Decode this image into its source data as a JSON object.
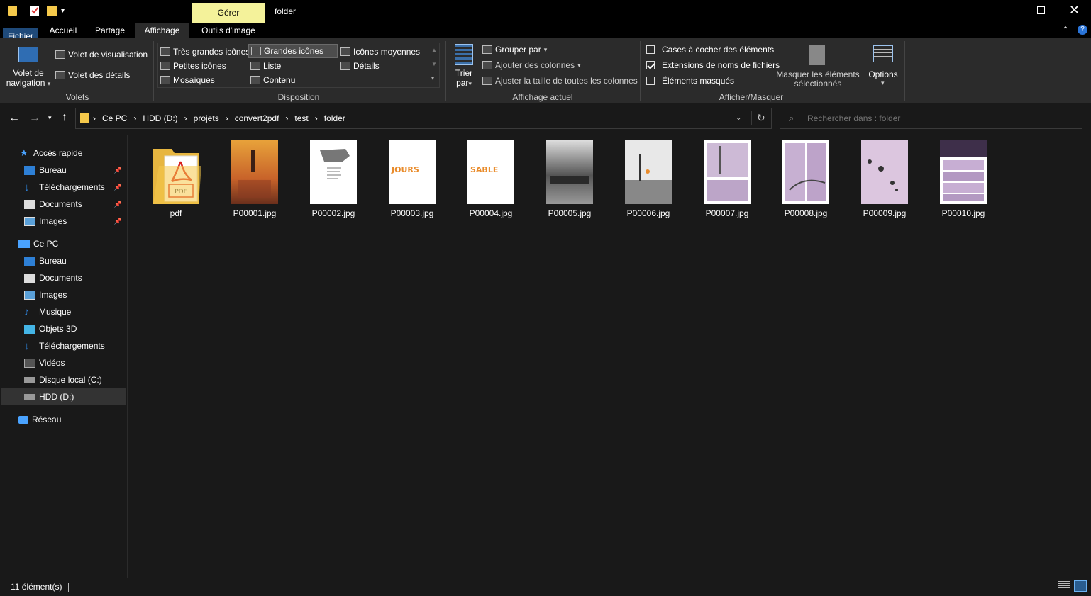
{
  "window": {
    "title": "folder"
  },
  "tabs": {
    "contextual": "Gérer",
    "fichier": "Fichier",
    "accueil": "Accueil",
    "partage": "Partage",
    "affichage": "Affichage",
    "outils": "Outils d'image"
  },
  "ribbon": {
    "volets": {
      "label": "Volets",
      "nav_pane_1": "Volet de",
      "nav_pane_2": "navigation",
      "preview": "Volet de visualisation",
      "details": "Volet des détails"
    },
    "disposition": {
      "label": "Disposition",
      "tres_grandes": "Très grandes icônes",
      "grandes": "Grandes icônes",
      "moyennes": "Icônes moyennes",
      "petites": "Petites icônes",
      "liste": "Liste",
      "details": "Détails",
      "mosaiques": "Mosaïques",
      "contenu": "Contenu"
    },
    "affichage_actuel": {
      "label": "Affichage actuel",
      "trier_1": "Trier",
      "trier_2": "par",
      "grouper": "Grouper par",
      "ajouter_colonnes": "Ajouter des colonnes",
      "ajuster": "Ajuster la taille de toutes les colonnes"
    },
    "afficher_masquer": {
      "label": "Afficher/Masquer",
      "cases": "Cases à cocher des éléments",
      "cases_checked": false,
      "extensions": "Extensions de noms de fichiers",
      "extensions_checked": true,
      "masques": "Éléments masqués",
      "masques_checked": false,
      "masquer_1": "Masquer les éléments",
      "masquer_2": "sélectionnés"
    },
    "options": "Options"
  },
  "address": {
    "crumbs": [
      "Ce PC",
      "HDD (D:)",
      "projets",
      "convert2pdf",
      "test",
      "folder"
    ],
    "search_placeholder": "Rechercher dans : folder"
  },
  "nav": {
    "quick_access": "Accès rapide",
    "quick_items": [
      "Bureau",
      "Téléchargements",
      "Documents",
      "Images"
    ],
    "this_pc": "Ce PC",
    "pc_items": [
      "Bureau",
      "Documents",
      "Images",
      "Musique",
      "Objets 3D",
      "Téléchargements",
      "Vidéos",
      "Disque local (C:)",
      "HDD (D:)"
    ],
    "network": "Réseau"
  },
  "files": [
    {
      "name": "pdf",
      "kind": "folder"
    },
    {
      "name": "P00001.jpg",
      "kind": "cover"
    },
    {
      "name": "P00002.jpg",
      "kind": "map"
    },
    {
      "name": "P00003.jpg",
      "kind": "title-jours"
    },
    {
      "name": "P00004.jpg",
      "kind": "title-sable"
    },
    {
      "name": "P00005.jpg",
      "kind": "photo"
    },
    {
      "name": "P00006.jpg",
      "kind": "photo2"
    },
    {
      "name": "P00007.jpg",
      "kind": "comic"
    },
    {
      "name": "P00008.jpg",
      "kind": "comic2"
    },
    {
      "name": "P00009.jpg",
      "kind": "comic3"
    },
    {
      "name": "P00010.jpg",
      "kind": "comic4"
    }
  ],
  "pdf_icon_text": "PDF",
  "thumb_text": {
    "jours": "JOURS",
    "sable": "SABLE"
  },
  "status": {
    "count": "11 élément(s)"
  },
  "colors": {
    "accent": "#f4f29a",
    "file_tab": "#1f4a7a",
    "folder": "#f5c94b",
    "pdf_red": "#d8221f"
  }
}
